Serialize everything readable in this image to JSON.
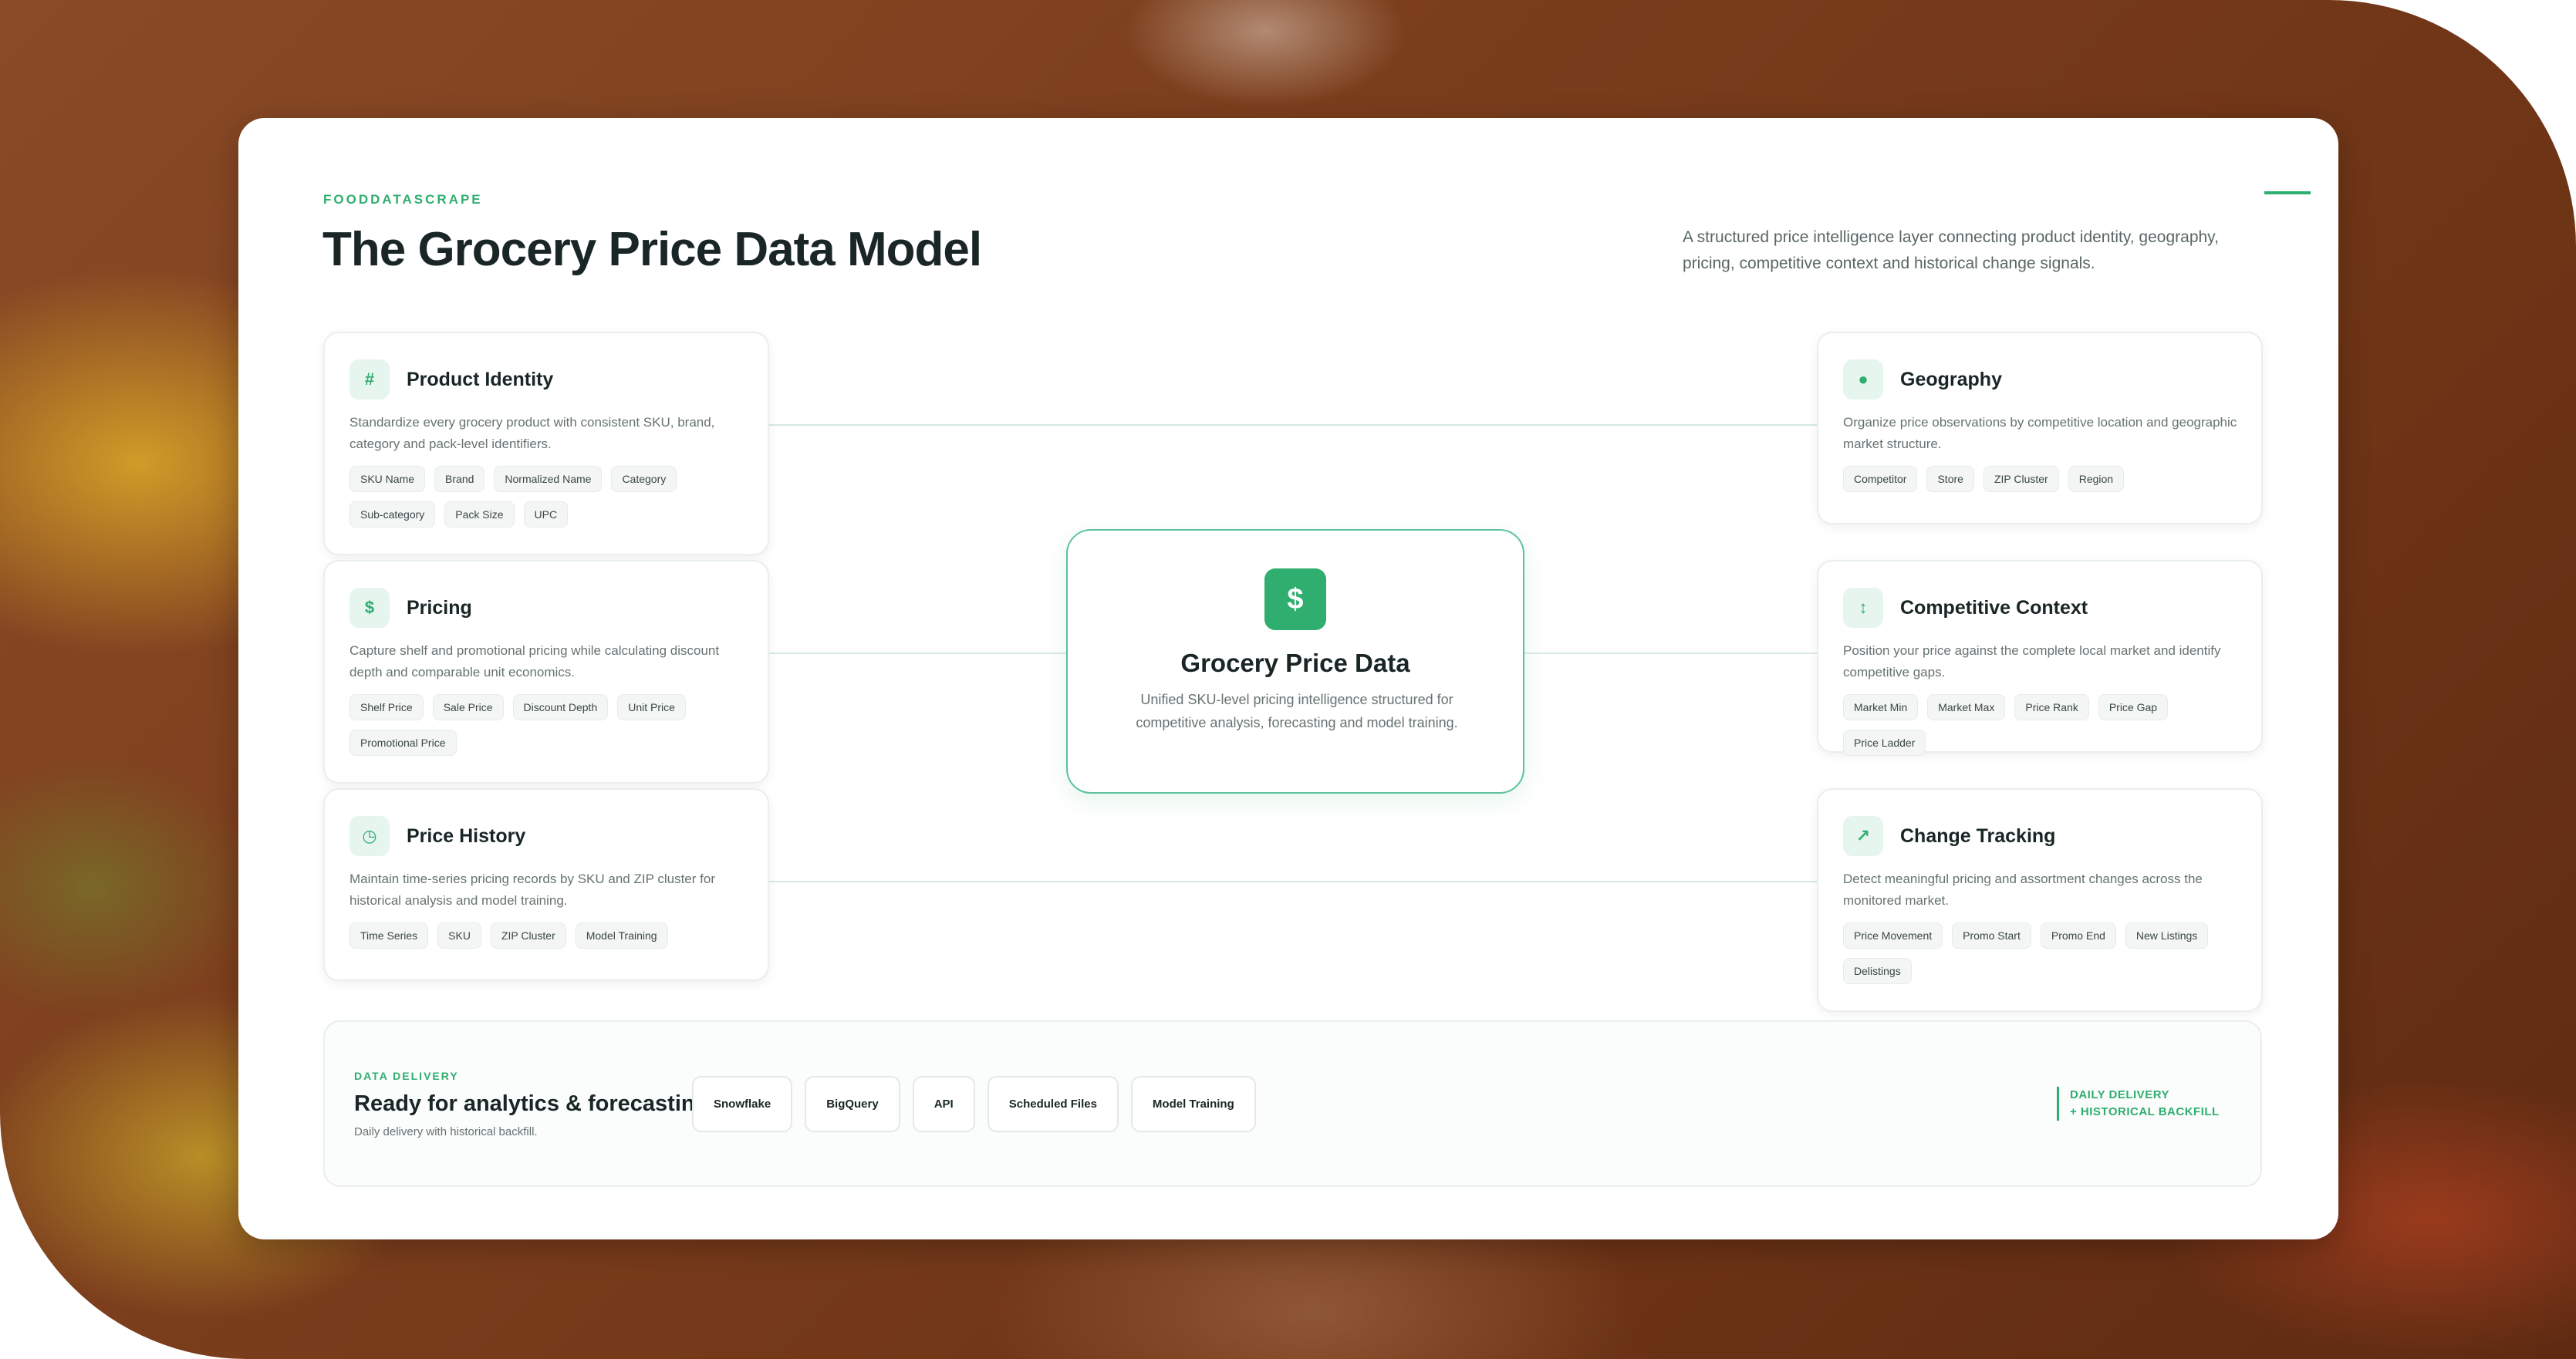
{
  "brand": "FOODDATASCRAPE",
  "title": "The Grocery Price Data Model",
  "intro": "A structured price intelligence layer connecting product identity, geography, pricing, competitive context and historical change signals.",
  "center": {
    "icon": "$",
    "icon_name": "dollar-icon",
    "title": "Grocery Price Data",
    "description": "Unified SKU-level pricing intelligence structured for competitive analysis, forecasting and model training."
  },
  "left_cards": [
    {
      "icon": "#",
      "icon_name": "hash-icon",
      "title": "Product Identity",
      "description": "Standardize every grocery product with consistent SKU, brand, category and pack-level identifiers.",
      "chips": [
        "SKU Name",
        "Brand",
        "Normalized Name",
        "Category",
        "Sub-category",
        "Pack Size",
        "UPC"
      ]
    },
    {
      "icon": "$",
      "icon_name": "dollar-icon",
      "title": "Pricing",
      "description": "Capture shelf and promotional pricing while calculating discount depth and comparable unit economics.",
      "chips": [
        "Shelf Price",
        "Sale Price",
        "Discount Depth",
        "Unit Price",
        "Promotional Price"
      ]
    },
    {
      "icon": "◷",
      "icon_name": "clock-icon",
      "title": "Price History",
      "description": "Maintain time-series pricing records by SKU and ZIP cluster for historical analysis and model training.",
      "chips": [
        "Time Series",
        "SKU",
        "ZIP Cluster",
        "Model Training"
      ]
    }
  ],
  "right_cards": [
    {
      "icon": "●",
      "icon_name": "location-pin-icon",
      "title": "Geography",
      "description": "Organize price observations by competitive location and geographic market structure.",
      "chips": [
        "Competitor",
        "Store",
        "ZIP Cluster",
        "Region"
      ]
    },
    {
      "icon": "↕",
      "icon_name": "up-down-arrow-icon",
      "title": "Competitive Context",
      "description": "Position your price against the complete local market and identify competitive gaps.",
      "chips": [
        "Market Min",
        "Market Max",
        "Price Rank",
        "Price Gap",
        "Price Ladder"
      ]
    },
    {
      "icon": "↗",
      "icon_name": "trend-arrow-icon",
      "title": "Change Tracking",
      "description": "Detect meaningful pricing and assortment changes across the monitored market.",
      "chips": [
        "Price Movement",
        "Promo Start",
        "Promo End",
        "New Listings",
        "Delistings"
      ]
    }
  ],
  "delivery": {
    "eyebrow": "DATA DELIVERY",
    "title": "Ready for analytics & forecasting",
    "subtitle": "Daily delivery with historical backfill.",
    "buttons": [
      "Snowflake",
      "BigQuery",
      "API",
      "Scheduled Files",
      "Model Training"
    ],
    "note_line1": "DAILY DELIVERY",
    "note_line2": "+ HISTORICAL BACKFILL"
  },
  "colors": {
    "accent": "#2fae6f",
    "text": "#1a2626",
    "muted": "#667272"
  }
}
